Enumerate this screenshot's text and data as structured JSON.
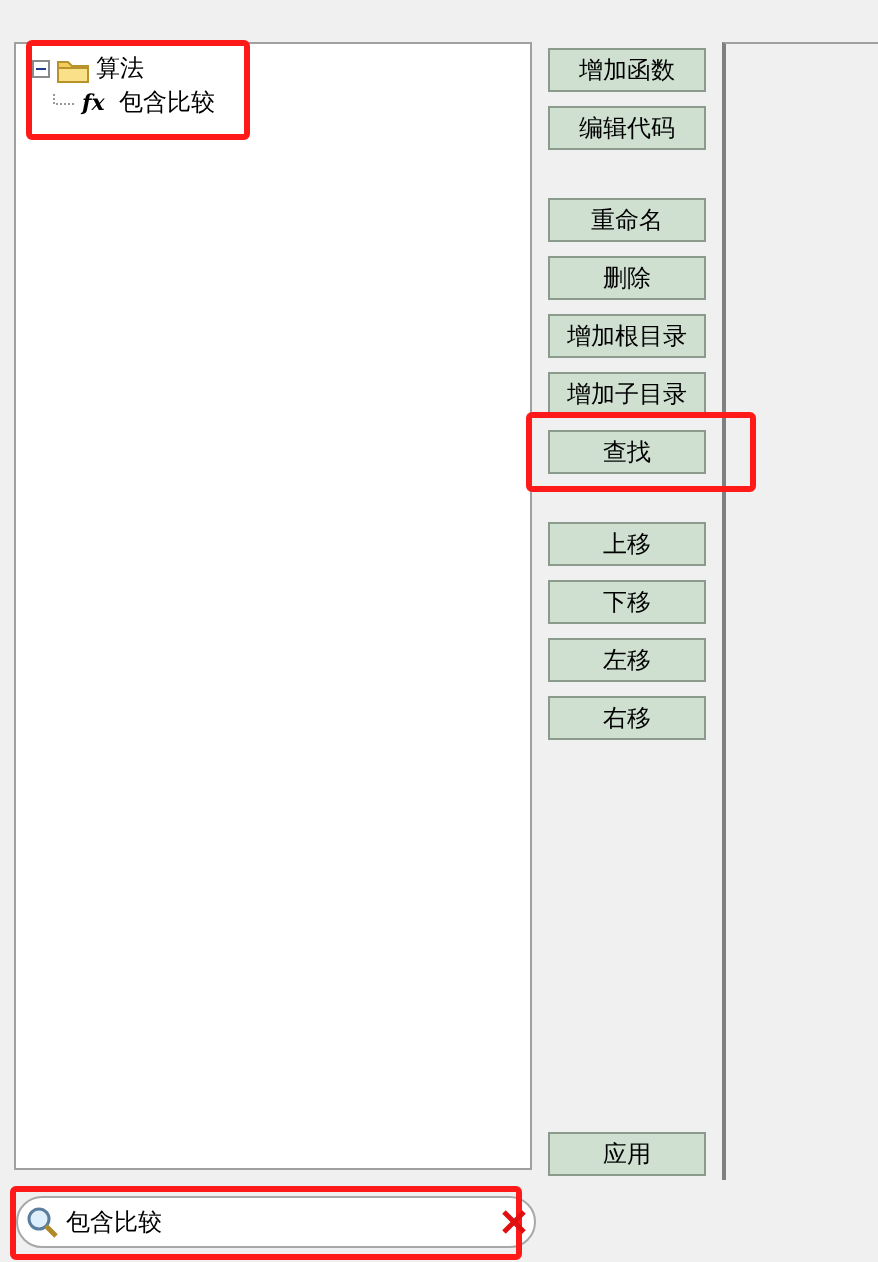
{
  "tree": {
    "items": [
      {
        "label": "算法",
        "expanded": true,
        "highlighted": true,
        "children": [
          {
            "label": "包含比较",
            "symbol": "fx"
          }
        ]
      }
    ]
  },
  "button_groups": [
    [
      {
        "label": "增加函数",
        "highlighted": false
      },
      {
        "label": "编辑代码",
        "highlighted": false
      }
    ],
    [
      {
        "label": "重命名",
        "highlighted": false
      },
      {
        "label": "删除",
        "highlighted": false
      },
      {
        "label": "增加根目录",
        "highlighted": false
      },
      {
        "label": "增加子目录",
        "highlighted": false
      },
      {
        "label": "查找",
        "highlighted": true
      }
    ],
    [
      {
        "label": "上移",
        "highlighted": false
      },
      {
        "label": "下移",
        "highlighted": false
      },
      {
        "label": "左移",
        "highlighted": false
      },
      {
        "label": "右移",
        "highlighted": false
      }
    ]
  ],
  "apply_button": {
    "label": "应用"
  },
  "search": {
    "value": "包含比较",
    "highlighted": true
  }
}
